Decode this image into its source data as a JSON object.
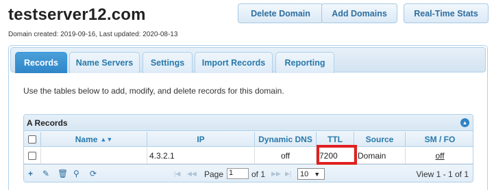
{
  "domain_title": "testserver12.com",
  "domain_meta": "Domain created: 2019-09-16, Last updated: 2020-08-13",
  "actions": {
    "delete_domain": "Delete Domain",
    "add_domains": "Add Domains",
    "real_time_stats": "Real-Time Stats"
  },
  "tabs": [
    {
      "label": "Records",
      "active": true
    },
    {
      "label": "Name Servers",
      "active": false
    },
    {
      "label": "Settings",
      "active": false
    },
    {
      "label": "Import Records",
      "active": false
    },
    {
      "label": "Reporting",
      "active": false
    }
  ],
  "intro_text": "Use the tables below to add, modify, and delete records for this domain.",
  "a_records": {
    "caption": "A Records",
    "columns": {
      "name": "Name",
      "ip": "IP",
      "dynamic_dns": "Dynamic DNS",
      "ttl": "TTL",
      "source": "Source",
      "smfo": "SM / FO"
    },
    "rows": [
      {
        "name": "",
        "ip": "4.3.2.1",
        "dynamic_dns": "off",
        "ttl": "7200",
        "source": "Domain",
        "smfo": "off"
      }
    ],
    "pager": {
      "page_label": "Page",
      "page_value": "1",
      "of_label": "of 1",
      "rows_per_page": "10",
      "view_text": "View 1 - 1 of 1"
    }
  },
  "highlight_color": "#e02020"
}
